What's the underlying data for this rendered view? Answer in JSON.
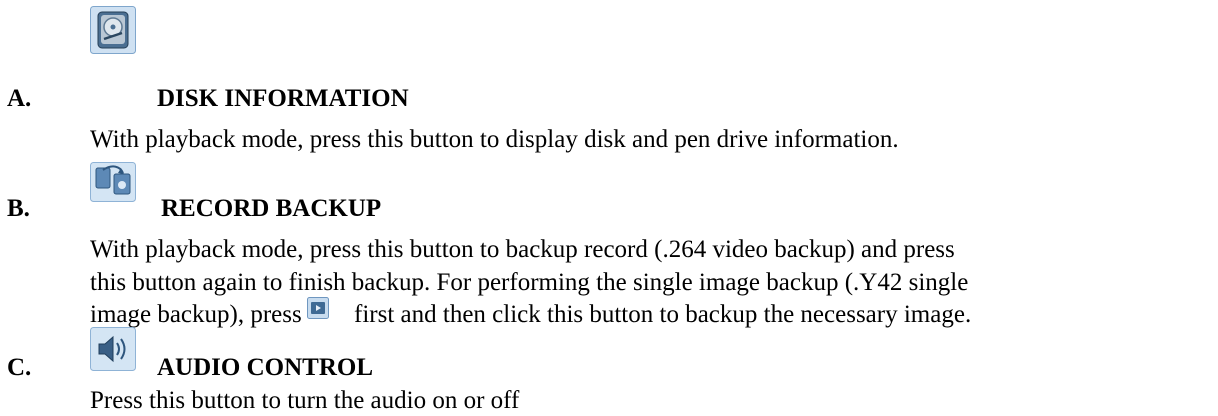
{
  "sections": [
    {
      "letter": "A.",
      "icon": "disk-information-icon",
      "title": "DISK INFORMATION",
      "lines": [
        "With playback mode, press this button to display disk and pen drive information."
      ]
    },
    {
      "letter": "B.",
      "icon": "record-backup-icon",
      "title": "RECORD BACKUP",
      "lines": [
        "With playback mode, press this button to backup record (.264 video backup) and press",
        "this button again to finish backup. For performing the single image backup (.Y42 single"
      ],
      "line3_before": "image backup), press",
      "line3_inline_icon": "snapshot-icon",
      "line3_after": "first and then click this button to backup the necessary image."
    },
    {
      "letter": "C.",
      "icon": "audio-control-icon",
      "title": "AUDIO CONTROL",
      "lines": [
        "Press this button to turn the audio on or off"
      ]
    }
  ],
  "colors": {
    "text": "#000000",
    "icon_frame": "#5a8fc4",
    "icon_bg": "#c9dff2"
  }
}
